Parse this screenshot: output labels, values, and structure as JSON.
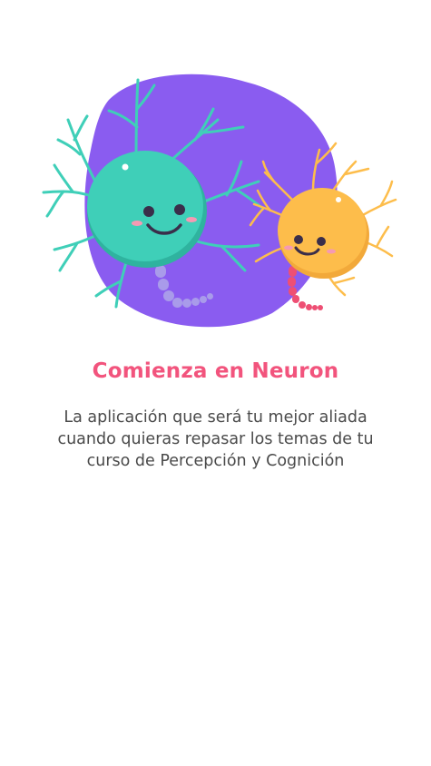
{
  "colors": {
    "background": "#ffffff",
    "title": "#f2547d",
    "description": "#4a4a4a",
    "blob": "#8a5cf0",
    "teal_neuron": "#3fcfb8",
    "teal_neuron_shade": "#2fb39f",
    "yellow_neuron": "#fdbd4b",
    "yellow_neuron_shade": "#f2a93a",
    "teal_axon": "#a99bea",
    "yellow_axon": "#ee4f74",
    "cheek": "#f59ab3",
    "face": "#3a2e4a"
  },
  "illustration": {
    "icon": "neuron-friends-illustration"
  },
  "onboarding": {
    "title": "Comienza en Neuron",
    "description": "La aplicación que será tu mejor aliada cuando quieras repasar los temas de tu curso de Percepción y Cognición"
  }
}
